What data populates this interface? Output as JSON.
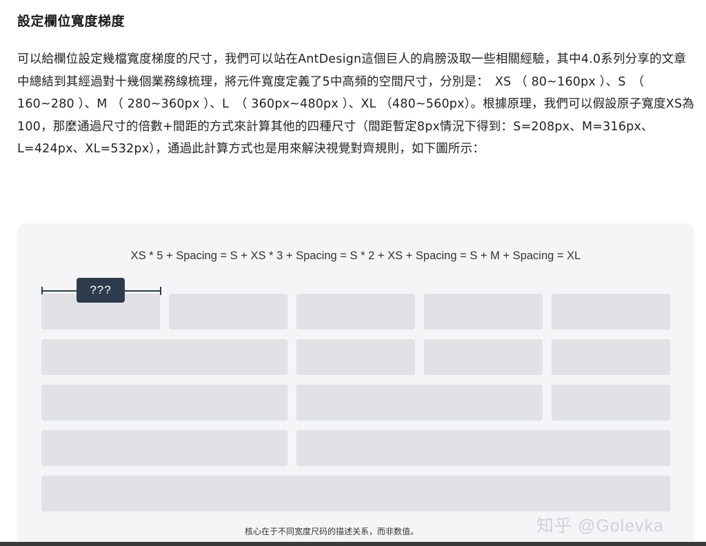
{
  "article": {
    "heading": "設定欄位寬度梯度",
    "paragraph": "可以給欄位設定幾檔寬度梯度的尺寸，我們可以站在AntDesign這個巨人的肩膀汲取一些相關經驗，其中4.0系列分享的文章中總結到其經過對十幾個業務線梳理，將元件寬度定義了5中高頻的空間尺寸，分別是：　XS （ 80~160px ）、S　（ 160~280 ）、M （ 280~360px ）、L　（ 360px~480px ）、XL （480~560px）。根據原理，我們可以假設原子寬度XS為100，那麼通過尺寸的倍數+間距的方式來計算其他的四種尺寸（間距暫定8px情況下得到：S=208px、M=316px、L=424px、XL=532px），通過此計算方式也是用來解決視覺對齊規則，如下圖所示："
  },
  "figure": {
    "formula": "XS * 5 + Spacing = S + XS * 3 + Spacing = S * 2 + XS + Spacing = S + M + Spacing = XL",
    "measure_label": "???",
    "caption": "核心在于不同宽度尺码的描述关系，而非数值。",
    "rows": [
      {
        "name": "row-xs-5",
        "blocks": 5
      },
      {
        "name": "row-s-xs-3",
        "blocks": 4
      },
      {
        "name": "row-s-2-xs",
        "blocks": 3
      },
      {
        "name": "row-s-m",
        "blocks": 2
      },
      {
        "name": "row-xl",
        "blocks": 1
      }
    ]
  },
  "watermark": "知乎 @Golevka",
  "colors": {
    "figure_bg": "#f5f5f7",
    "block": "#e1e2e6",
    "label_bg": "#2d3b4c"
  }
}
